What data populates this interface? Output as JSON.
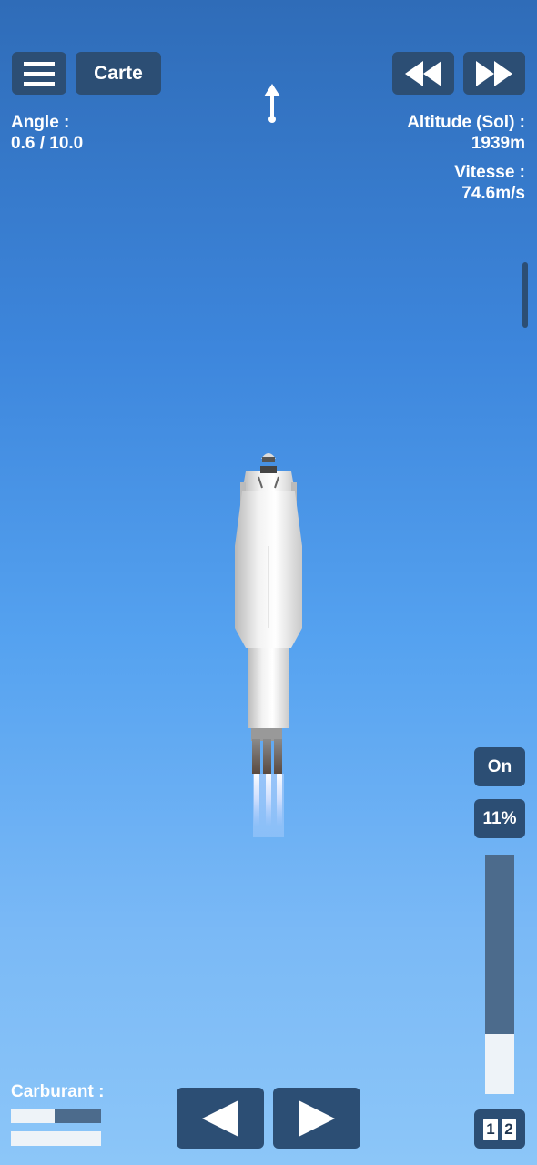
{
  "header": {
    "map_label": "Carte",
    "menu_icon": "hamburger-menu-icon",
    "rewind_icon": "rewind-icon",
    "fast_forward_icon": "fast-forward-icon",
    "direction_icon": "up-arrow-icon"
  },
  "telemetry": {
    "angle_label": "Angle :",
    "angle_value": "0.6 / 10.0",
    "altitude_label": "Altitude (Sol) :",
    "altitude_value": "1939m",
    "speed_label": "Vitesse :",
    "speed_value": "74.6m/s"
  },
  "throttle": {
    "toggle_label": "On",
    "percent_label": "11%",
    "level": 0.25
  },
  "fuel": {
    "label": "Carburant :",
    "stage1_level": 0.48,
    "stage2_level": 1.0
  },
  "controls": {
    "rotate_left_icon": "left-triangle-icon",
    "rotate_right_icon": "right-triangle-icon",
    "stage_digit_1": "1",
    "stage_digit_2": "2"
  },
  "colors": {
    "button_bg": "#2c4e74",
    "sky_top": "#2f6cb8",
    "sky_bottom": "#8cc6f8"
  }
}
